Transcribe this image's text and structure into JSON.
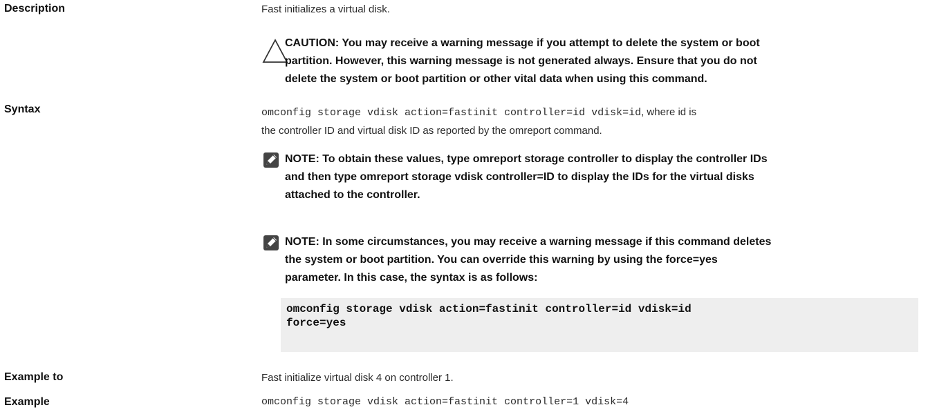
{
  "rows": {
    "description": {
      "label": "Description",
      "text": "Fast initializes a virtual disk.",
      "caution_icon": "warning-triangle-icon",
      "caution": [
        "CAUTION: You may receive a warning message if you attempt to delete the system or boot",
        "partition. However, this warning message is not generated always. Ensure that you do not",
        "delete the system or boot partition or other vital data when using this command."
      ]
    },
    "syntax": {
      "label": "Syntax",
      "command": "omconfig storage vdisk action=fastinit controller=id vdisk=id",
      "text_after": ", where id is",
      "text_line2": "the controller ID and virtual disk ID as reported by the omreport command.",
      "note_icon": "pencil-note-icon",
      "note1": [
        "NOTE: To obtain these values, type omreport storage controller to display the controller IDs",
        "and then type omreport storage vdisk controller=ID to display the IDs for the virtual disks",
        "attached to the controller."
      ],
      "note2": [
        "NOTE: In some circumstances, you may receive a warning message if this command deletes",
        "the system or boot partition. You can override this warning by using the force=yes",
        "parameter. In this case, the syntax is as follows:"
      ],
      "code": [
        "omconfig storage vdisk action=fastinit controller=id vdisk=id",
        "force=yes"
      ]
    },
    "example_to": {
      "label": "Example to",
      "text": "Fast initialize virtual disk 4 on controller 1."
    },
    "example": {
      "label": "Example",
      "command": "omconfig storage vdisk action=fastinit controller=1 vdisk=4"
    }
  }
}
